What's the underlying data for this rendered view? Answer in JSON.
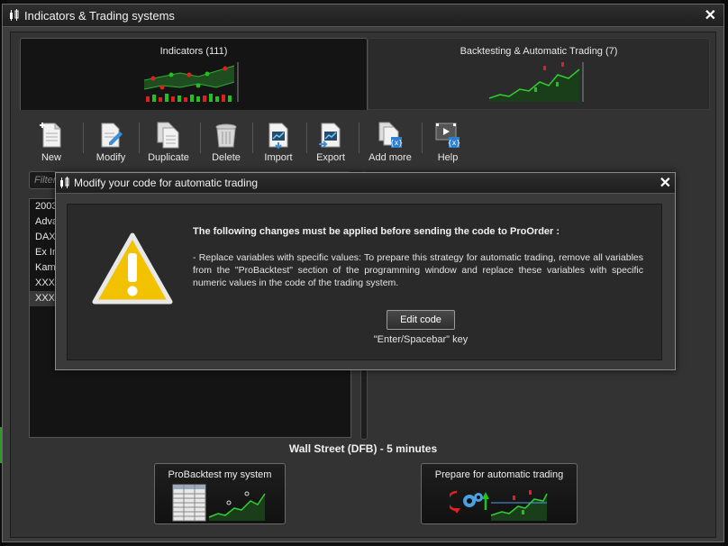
{
  "window": {
    "title": "Indicators & Trading systems"
  },
  "tabs": [
    {
      "label": "Indicators (111)"
    },
    {
      "label": "Backtesting & Automatic Trading (7)"
    }
  ],
  "toolbar": {
    "new": "New",
    "modify": "Modify",
    "duplicate": "Duplicate",
    "delete": "Delete",
    "import": "Import",
    "export": "Export",
    "add_more": "Add more",
    "help": "Help"
  },
  "filter": {
    "placeholder": "Filter"
  },
  "list": {
    "items": [
      "2003",
      "Adva",
      "DAX",
      "Ex In",
      "Kama",
      "XXXI",
      "XXXI"
    ],
    "selected_index": 6
  },
  "instrument": "Wall Street (DFB) - 5 minutes",
  "buttons": {
    "probacktest": "ProBacktest my system",
    "prepare": "Prepare for automatic trading"
  },
  "dialog": {
    "title": "Modify your code for automatic trading",
    "heading": "The following changes must be applied before sending the code to ProOrder :",
    "body": "- Replace variables with specific values: To prepare this strategy for automatic trading, remove all variables from the \"ProBacktest\" section of the programming window and replace these variables with specific numeric values in the code of the trading system.",
    "edit_button": "Edit code",
    "key_hint": "\"Enter/Spacebar\" key"
  },
  "colors": {
    "accent_green": "#22c022",
    "warning_yellow": "#f2c200",
    "chart_red": "#e02020"
  }
}
